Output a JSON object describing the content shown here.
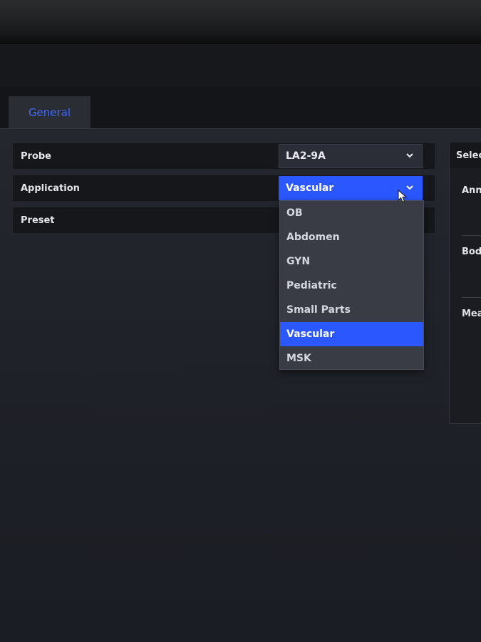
{
  "tabs": [
    {
      "label": "General",
      "active": true
    }
  ],
  "settings": {
    "probe": {
      "label": "Probe",
      "value": "LA2-9A"
    },
    "application": {
      "label": "Application",
      "value": "Vascular"
    },
    "preset": {
      "label": "Preset"
    }
  },
  "dropdown": {
    "options": [
      "OB",
      "Abdomen",
      "GYN",
      "Pediatric",
      "Small Parts",
      "Vascular",
      "MSK"
    ],
    "selected": "Vascular"
  },
  "side_panel": {
    "header": "Select",
    "items": [
      "Anno",
      "Body",
      "Mea"
    ]
  },
  "colors": {
    "accent": "#2a57ff",
    "tab_text": "#3f69ff",
    "background": "#1d2026"
  },
  "icons": {
    "chevron": "chevron-down-icon",
    "cursor": "mouse-pointer-icon"
  }
}
